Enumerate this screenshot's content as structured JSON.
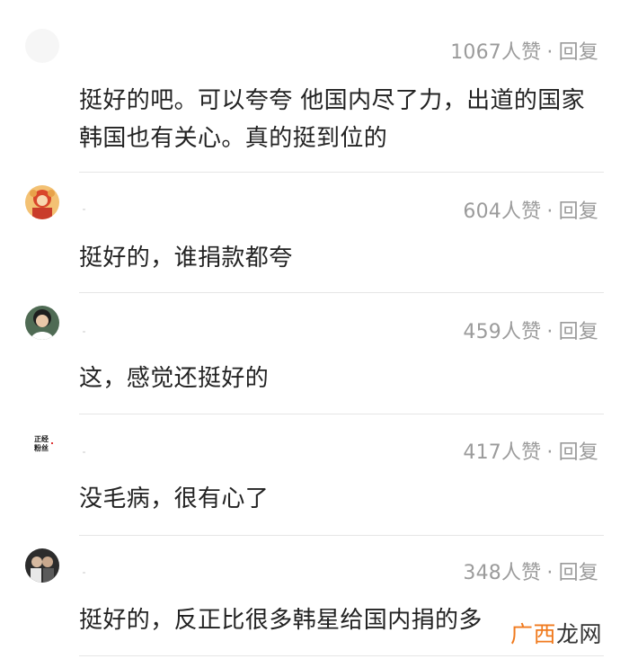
{
  "comments": [
    {
      "likes": "1067人赞",
      "separator": "·",
      "reply": "回复",
      "text": "挺好的吧。可以夸夸 他国内尽了力，出道的国家韩国也有关心。真的挺到位的"
    },
    {
      "likes": "604人赞",
      "separator": "·",
      "reply": "回复",
      "text": "挺好的，谁捐款都夸"
    },
    {
      "likes": "459人赞",
      "separator": "·",
      "reply": "回复",
      "text": "这，感觉还挺好的"
    },
    {
      "likes": "417人赞",
      "separator": "·",
      "reply": "回复",
      "text": "没毛病，很有心了",
      "avatar_text": [
        "正经",
        "粉丝"
      ]
    },
    {
      "likes": "348人赞",
      "separator": "·",
      "reply": "回复",
      "text": "挺好的，反正比很多韩星给国内捐的多"
    }
  ],
  "watermark": {
    "part1": "广西",
    "part2": "龙网"
  },
  "colors": {
    "meta_text": "#9b9b9b",
    "body_text": "#222222",
    "divider": "#e6e6e6",
    "watermark_accent": "#f07a1e"
  }
}
